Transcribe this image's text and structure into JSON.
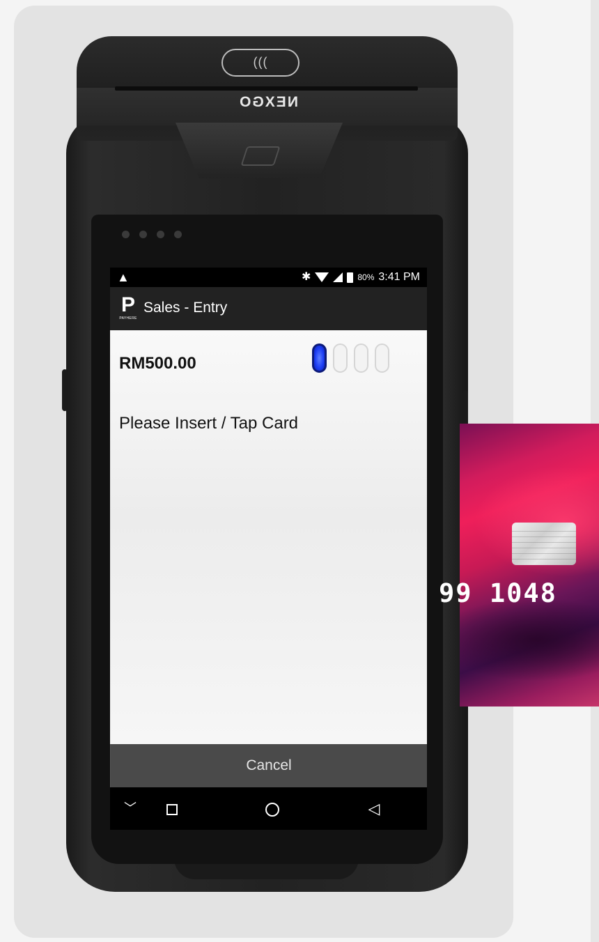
{
  "device": {
    "brand": "NEXGO",
    "contactless_symbol": "((("
  },
  "status_bar": {
    "battery": "80%",
    "time": "3:41 PM"
  },
  "app_bar": {
    "logo_letter": "P",
    "logo_wordmark": "PAYHERE",
    "title": "Sales - Entry"
  },
  "transaction": {
    "amount": "RM500.00",
    "progress_steps": 4,
    "current_step": 1,
    "prompt": "Please Insert / Tap Card"
  },
  "buttons": {
    "cancel_label": "Cancel"
  },
  "nav_bar": {
    "collapse": "﹀",
    "back": "◁"
  },
  "card": {
    "number_fragment": "99 1048 "
  },
  "colors": {
    "status_bar_bg": "#000000",
    "app_bar_bg": "#222222",
    "cancel_bg": "#4a4a4a",
    "progress_active": "#1f40f5",
    "card_accent": "#ef1f5a"
  }
}
